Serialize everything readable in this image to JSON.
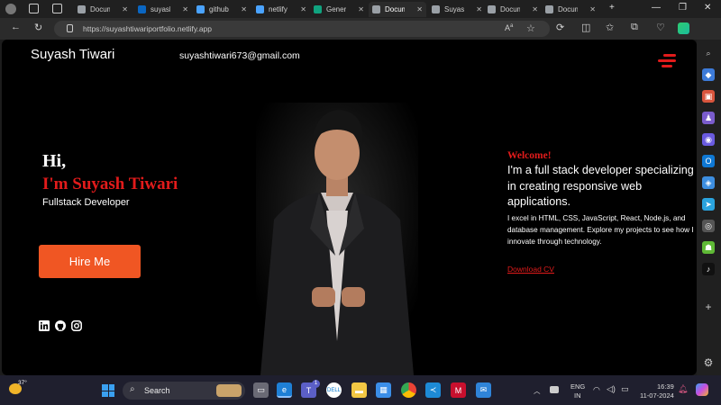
{
  "browser": {
    "tabs": [
      {
        "title": "Docum",
        "icon": "document-icon",
        "color": "#9aa0a6",
        "active": false
      },
      {
        "title": "suyash",
        "icon": "linkedin-icon",
        "color": "#0a66c2",
        "active": false
      },
      {
        "title": "github",
        "icon": "search-icon",
        "color": "#4aa3ff",
        "active": false
      },
      {
        "title": "netlify",
        "icon": "search-icon",
        "color": "#4aa3ff",
        "active": false
      },
      {
        "title": "Genera",
        "icon": "chatgpt-icon",
        "color": "#10a37f",
        "active": false
      },
      {
        "title": "Docum",
        "icon": "document-icon",
        "color": "#9aa0a6",
        "active": true
      },
      {
        "title": "Suyash",
        "icon": "document-icon",
        "color": "#9aa0a6",
        "active": false
      },
      {
        "title": "Docum",
        "icon": "document-icon",
        "color": "#9aa0a6",
        "active": false
      },
      {
        "title": "Docum",
        "icon": "document-icon",
        "color": "#9aa0a6",
        "active": false
      }
    ],
    "url": "https://suyashtiwariportfolio.netlify.app"
  },
  "site": {
    "brand": "Suyash Tiwari",
    "email": "suyashtiwari673@gmail.com",
    "accent": "#e21b1b",
    "hero": {
      "greeting": "Hi,",
      "name": "I'm Suyash Tiwari",
      "role": "Fullstack Developer",
      "hire_button": "Hire Me",
      "button_color": "#f05623"
    },
    "socials": [
      "linkedin-icon",
      "github-icon",
      "instagram-icon"
    ],
    "about": {
      "welcome": "Welcome!",
      "headline": "I'm a full stack developer specializing in creating responsive web applications.",
      "description": "I excel in HTML, CSS, JavaScript, React, Node.js, and database management. Explore my projects to see how I innovate through technology.",
      "cv_link": "Download CV"
    }
  },
  "taskbar": {
    "weather": "37°",
    "search_placeholder": "Search",
    "teams_badge": "1",
    "lang_top": "ENG",
    "lang_bottom": "IN",
    "time": "16:39",
    "date": "11-07-2024"
  }
}
